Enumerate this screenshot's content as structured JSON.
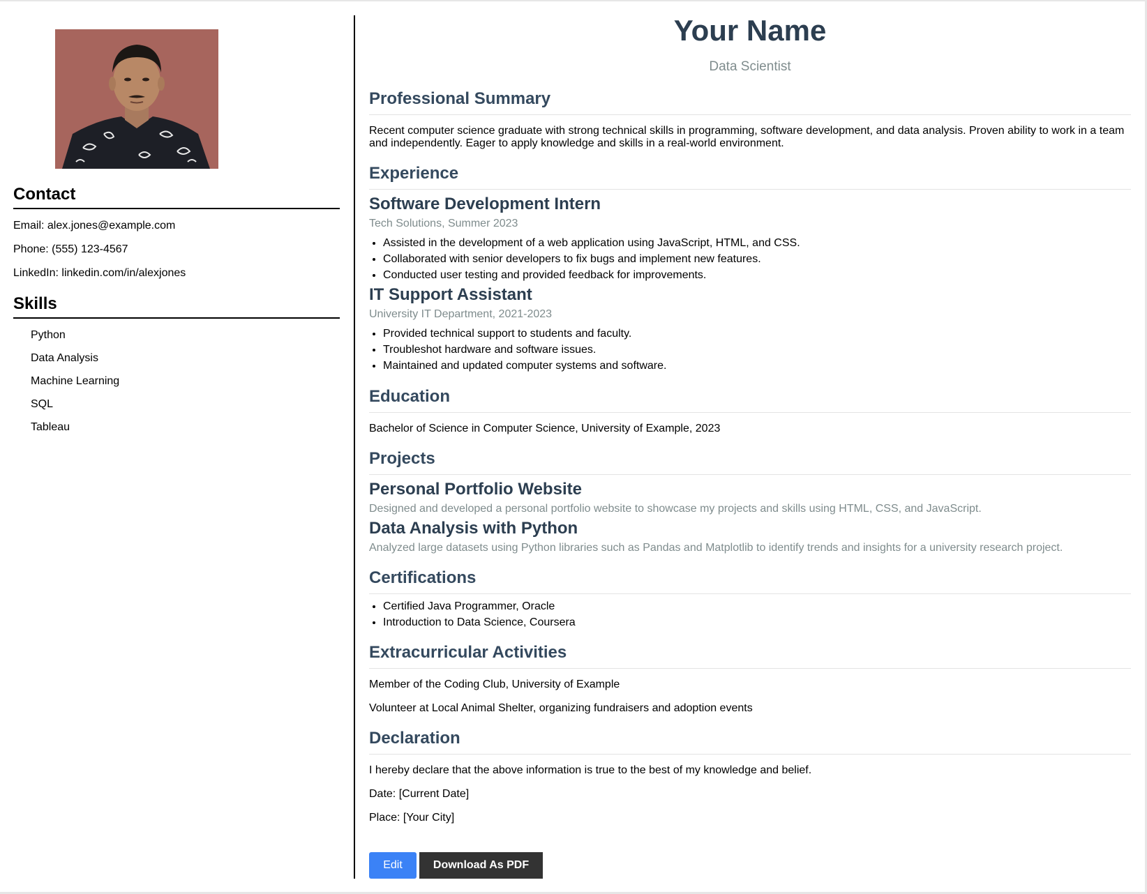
{
  "sidebar": {
    "photo_alt": "profile photo",
    "contact_title": "Contact",
    "contact": {
      "email": "Email: alex.jones@example.com",
      "phone": "Phone: (555) 123-4567",
      "linkedin": "LinkedIn: linkedin.com/in/alexjones"
    },
    "skills_title": "Skills",
    "skills": [
      "Python",
      "Data Analysis",
      "Machine Learning",
      "SQL",
      "Tableau"
    ]
  },
  "header": {
    "name": "Your Name",
    "role": "Data Scientist"
  },
  "summary": {
    "title": "Professional Summary",
    "text": "Recent computer science graduate with strong technical skills in programming, software development, and data analysis. Proven ability to work in a team and independently. Eager to apply knowledge and skills in a real-world environment."
  },
  "experience": {
    "title": "Experience",
    "jobs": [
      {
        "title": "Software Development Intern",
        "meta": "Tech Solutions, Summer 2023",
        "bullets": [
          "Assisted in the development of a web application using JavaScript, HTML, and CSS.",
          "Collaborated with senior developers to fix bugs and implement new features.",
          "Conducted user testing and provided feedback for improvements."
        ]
      },
      {
        "title": "IT Support Assistant",
        "meta": "University IT Department, 2021-2023",
        "bullets": [
          "Provided technical support to students and faculty.",
          "Troubleshot hardware and software issues.",
          "Maintained and updated computer systems and software."
        ]
      }
    ]
  },
  "education": {
    "title": "Education",
    "text": "Bachelor of Science in Computer Science, University of Example, 2023"
  },
  "projects": {
    "title": "Projects",
    "items": [
      {
        "title": "Personal Portfolio Website",
        "desc": "Designed and developed a personal portfolio website to showcase my projects and skills using HTML, CSS, and JavaScript."
      },
      {
        "title": "Data Analysis with Python",
        "desc": "Analyzed large datasets using Python libraries such as Pandas and Matplotlib to identify trends and insights for a university research project."
      }
    ]
  },
  "certifications": {
    "title": "Certifications",
    "items": [
      "Certified Java Programmer, Oracle",
      "Introduction to Data Science, Coursera"
    ]
  },
  "extracurricular": {
    "title": "Extracurricular Activities",
    "items": [
      "Member of the Coding Club, University of Example",
      "Volunteer at Local Animal Shelter, organizing fundraisers and adoption events"
    ]
  },
  "declaration": {
    "title": "Declaration",
    "text": "I hereby declare that the above information is true to the best of my knowledge and belief.",
    "date": "Date: [Current Date]",
    "place": "Place: [Your City]"
  },
  "actions": {
    "edit_label": "Edit",
    "pdf_label": "Download As PDF"
  },
  "colors": {
    "heading": "#2c3e50",
    "section": "#34495e",
    "muted": "#7f8c8d",
    "edit_button": "#3b82f6",
    "pdf_button": "#333333"
  }
}
